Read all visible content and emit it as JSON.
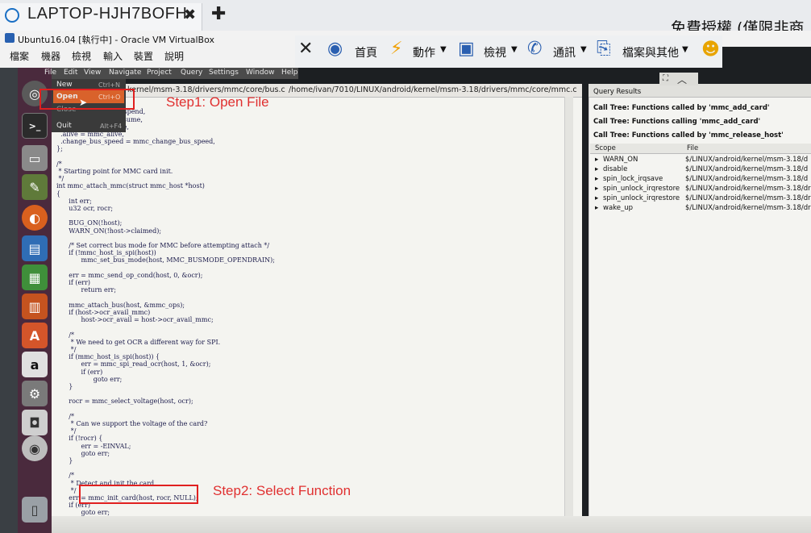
{
  "browser_tab": {
    "title": "LAPTOP-HJH7BOFH",
    "close": "✖",
    "new_tab": "✚"
  },
  "banner_text": "免費授權 (僅限非商",
  "vbox": {
    "title": "Ubuntu16.04 [執行中] - Oracle VM VirtualBox",
    "menu": [
      "檔案",
      "機器",
      "檢視",
      "輸入",
      "裝置",
      "說明"
    ]
  },
  "remote_toolbar": {
    "home": "首頁",
    "actions": "動作",
    "view": "檢視",
    "communicate": "通訊",
    "files": "檔案與其他"
  },
  "app_menu": [
    "File",
    "Edit",
    "View",
    "Navigate",
    "Project",
    "Query",
    "Settings",
    "Window",
    "Help"
  ],
  "file_menu": {
    "new": {
      "label": "New",
      "shortcut": "Ctrl+N"
    },
    "open": {
      "label": "Open",
      "shortcut": "Ctrl+O"
    },
    "close": {
      "label": "Close"
    },
    "quit": {
      "label": "Quit",
      "shortcut": "Alt+F4"
    }
  },
  "editor_tabs": [
    "kernel/msm-3.18/drivers/mmc/core/bus.c",
    "/home/ivan/7010/LINUX/android/kernel/msm-3.18/drivers/mmc/core/mmc.c"
  ],
  "code": "  suspend,\n  sume,\n  = mmc_runtime_suspend,\n  = mmc_runtime_resume,\n  mmc_power_restore,\n  .alive = mmc_alive,\n  .change_bus_speed = mmc_change_bus_speed,\n};\n\n/*\n * Starting point for MMC card init.\n */\nint mmc_attach_mmc(struct mmc_host *host)\n{\n      int err;\n      u32 ocr, rocr;\n\n      BUG_ON(!host);\n      WARN_ON(!host->claimed);\n\n      /* Set correct bus mode for MMC before attempting attach */\n      if (!mmc_host_is_spi(host))\n            mmc_set_bus_mode(host, MMC_BUSMODE_OPENDRAIN);\n\n      err = mmc_send_op_cond(host, 0, &ocr);\n      if (err)\n            return err;\n\n      mmc_attach_bus(host, &mmc_ops);\n      if (host->ocr_avail_mmc)\n            host->ocr_avail = host->ocr_avail_mmc;\n\n      /*\n       * We need to get OCR a different way for SPI.\n       */\n      if (mmc_host_is_spi(host)) {\n            err = mmc_spi_read_ocr(host, 1, &ocr);\n            if (err)\n                  goto err;\n      }\n\n      rocr = mmc_select_voltage(host, ocr);\n\n      /*\n       * Can we support the voltage of the card?\n       */\n      if (!rocr) {\n            err = -EINVAL;\n            goto err;\n      }\n\n      /*\n       * Detect and init the card.\n       */\n      err = mmc_init_card(host, rocr, NULL);\n      if (err)\n            goto err;\n\n                  (host);",
  "query": {
    "title": "Query Results",
    "trees": [
      "Call Tree: Functions called by 'mmc_add_card'",
      "Call Tree: Functions calling 'mmc_add_card'",
      "Call Tree: Functions called by 'mmc_release_host'"
    ],
    "columns": [
      "Scope",
      "File"
    ],
    "rows": [
      {
        "scope": "WARN_ON",
        "file": "$/LINUX/android/kernel/msm-3.18/d"
      },
      {
        "scope": "disable",
        "file": "$/LINUX/android/kernel/msm-3.18/d"
      },
      {
        "scope": "spin_lock_irqsave",
        "file": "$/LINUX/android/kernel/msm-3.18/d"
      },
      {
        "scope": "spin_unlock_irqrestore",
        "file": "$/LINUX/android/kernel/msm-3.18/dr"
      },
      {
        "scope": "spin_unlock_irqrestore",
        "file": "$/LINUX/android/kernel/msm-3.18/dr"
      },
      {
        "scope": "wake_up",
        "file": "$/LINUX/android/kernel/msm-3.18/dr"
      }
    ]
  },
  "annotations": {
    "step1": "Step1: Open File",
    "step2": "Step2: Select Function"
  },
  "colors": {
    "launcher": "#4a2a3d",
    "highlight": "#d9622b",
    "annotation": "#e02020"
  }
}
